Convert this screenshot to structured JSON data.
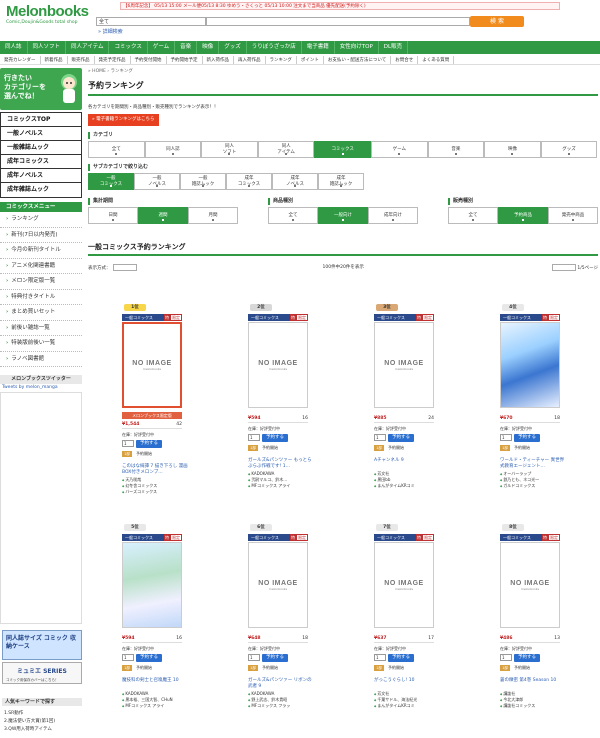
{
  "header": {
    "logo_main": "Melonbooks",
    "logo_sub": "Comic,Doujin&Goods total shop",
    "notice": "【6周年記念】 05/13 15:00 メール便05/13 8:30 ゆめう・さくっと 05/13 10:00 注文まで当商品 優先配送(予約除く)",
    "search_select": "全て",
    "search_button": "検 索",
    "search_detail": "» 詳細検索"
  },
  "global_nav": [
    "同人誌",
    "同人ソフト",
    "同人アイテム",
    "コミックス",
    "ゲーム",
    "音楽",
    "映像",
    "グッズ",
    "うりぼうざっか店",
    "電子書籍",
    "女性向けTOP",
    "DL販売"
  ],
  "sub_nav": [
    "発売カレンダー",
    "新着作品",
    "販売作品",
    "発売予定作品",
    "予約受付開始",
    "予約開始予定",
    "新入荷作品",
    "再入荷作品",
    "ランキング",
    "ポイント",
    "お支払い・配送方法について",
    "お問合せ",
    "よくある質問"
  ],
  "sidebar": {
    "banner_text": "行きたい\nカテゴリーを\n選んでね！",
    "categories": [
      "コミックスTOP",
      "一般ノベルス",
      "一般雑誌ムック",
      "成年コミックス",
      "成年ノベルス",
      "成年雑誌ムック"
    ],
    "menu_title": "コミックスメニュー",
    "menu_items": [
      "ランキング",
      "新刊(7日以内発売)",
      "今月の新刊タイトル",
      "アニメ化関連書籍",
      "メロン限定版一覧",
      "特典付きタイトル",
      "まとめ買いセット",
      "前後い雑誌一覧",
      "特装版前後い一覧",
      "ラノベ図書館"
    ],
    "twitter_title": "メロンブックスツイッター",
    "twitter_sub": "Tweets by melon_manga",
    "ad1": "同人誌サイズ コミック 収納ケース",
    "ad2": "ミュミエ SERIES",
    "ad2_sub": "コミック用保存カバーはこちら！",
    "keywords_title": "人気キーワードで探す",
    "keywords": [
      "1.SR動作",
      "2.魔法使い方大賞(第1回)",
      "3.QW用入荷時アイテム"
    ]
  },
  "main": {
    "breadcrumb": "» HOME › ランキング",
    "page_title": "予約ランキング",
    "description": "各カテゴリを期間別・商品種別・販売種別でランキング表示！！",
    "red_button": "» 電子書籍ランキングはこちら",
    "category_heading": "カテゴリ",
    "categories": [
      {
        "label": "全て",
        "on": false
      },
      {
        "label": "同人誌",
        "on": false
      },
      {
        "label": "同人\nソフト",
        "on": false
      },
      {
        "label": "同人\nアイテム",
        "on": false
      },
      {
        "label": "コミックス",
        "on": true
      },
      {
        "label": "ゲーム",
        "on": false
      },
      {
        "label": "音楽",
        "on": false
      },
      {
        "label": "映像",
        "on": false
      },
      {
        "label": "グッズ",
        "on": false
      }
    ],
    "subcategory_heading": "サブカテゴリで絞り込む",
    "subcategories": [
      {
        "label": "一般\nコミックス",
        "on": true
      },
      {
        "label": "一般\nノベルス",
        "on": false
      },
      {
        "label": "一般\n雑誌ムック",
        "on": false
      },
      {
        "label": "成年\nコミックス",
        "on": false
      },
      {
        "label": "成年\nノベルス",
        "on": false
      },
      {
        "label": "成年\n雑誌ムック",
        "on": false
      }
    ],
    "period_heading": "集計期間",
    "periods": [
      {
        "label": "日間",
        "on": false
      },
      {
        "label": "週間",
        "on": true
      },
      {
        "label": "月間",
        "on": false
      }
    ],
    "type_heading": "商品種別",
    "types": [
      {
        "label": "全て",
        "on": false
      },
      {
        "label": "一般向け",
        "on": true
      },
      {
        "label": "成年向け",
        "on": false
      }
    ],
    "sale_heading": "販売種別",
    "sales": [
      {
        "label": "全て",
        "on": false
      },
      {
        "label": "予約商品",
        "on": true
      },
      {
        "label": "発売中商品",
        "on": false
      }
    ],
    "ranking_title": "一般コミックス予約ランキング",
    "pager_left": "表示方式：",
    "pager_count": "100件中20件を表示",
    "pager_page": "1/5ページ"
  },
  "products": [
    {
      "rank": "1位",
      "badge": "b1",
      "cat": "一般コミックス",
      "image": "noimage",
      "red": true,
      "limited": "メロンブックス限定版",
      "price": "¥1,544",
      "points": "42",
      "status": "在庫：好評受付中",
      "qty": "1",
      "cart": "予約する",
      "label": "1部",
      "ltext": "予約開始",
      "title": "このはな綺譚 7 描き下ろし 漫画BOX付きメロンブ…",
      "meta": [
        "天乃咲哉",
        "幻冬舎コミックス",
        "バーズコミックス"
      ]
    },
    {
      "rank": "2位",
      "badge": "b2",
      "cat": "一般コミックス",
      "image": "noimage",
      "red": false,
      "price": "¥594",
      "points": "16",
      "status": "在庫：好評受付中",
      "qty": "1",
      "cart": "予約する",
      "label": "1部",
      "ltext": "予約開始",
      "title": "ガールズ&パンツァー もっとらぶらぶ作戦です! 1…",
      "meta": [
        "KADOKAWA",
        "弐尉マルコ、鈴木…",
        "MFコミックス アライ"
      ]
    },
    {
      "rank": "3位",
      "badge": "b3",
      "cat": "一般コミックス",
      "image": "noimage",
      "red": false,
      "price": "¥885",
      "points": "24",
      "status": "在庫：好評受付中",
      "qty": "1",
      "cart": "予約する",
      "label": "1部",
      "ltext": "予約開始",
      "title": "Aチャンネル 9",
      "meta": [
        "芳文社",
        "黒田bb",
        "まんがタイムKRコミ"
      ]
    },
    {
      "rank": "4位",
      "badge": "bn",
      "cat": "一般コミックス",
      "image": "cover",
      "red": false,
      "price": "¥670",
      "points": "18",
      "status": "在庫：好評受付中",
      "qty": "1",
      "cart": "予約する",
      "label": "1部",
      "ltext": "予約開始",
      "title": "ワールド・ティーチャー 異世界式教育エージェント…",
      "meta": [
        "オーバーラップ",
        "鉄乃とも、ネコ光一",
        "ガルドコミックス"
      ]
    },
    {
      "rank": "5位",
      "badge": "bn",
      "cat": "一般コミックス",
      "image": "cover2",
      "red": false,
      "price": "¥594",
      "points": "16",
      "status": "在庫：好評受付中",
      "qty": "1",
      "cart": "予約する",
      "label": "1部",
      "ltext": "予約開始",
      "title": "魔技科の剣士と召喚魔王 10",
      "meta": [
        "KADOKAWA",
        "黒本裕、三国大智、CHuN",
        "MFコミックス アライ"
      ]
    },
    {
      "rank": "6位",
      "badge": "bn",
      "cat": "一般コミックス",
      "image": "noimage",
      "red": false,
      "price": "¥648",
      "points": "18",
      "status": "在庫：好評受付中",
      "qty": "1",
      "cart": "予約する",
      "label": "1部",
      "ltext": "予約開始",
      "title": "ガールズ&パンツァー リボンの武者 9",
      "meta": [
        "KADOKAWA",
        "野上武志、鈴木貴昭",
        "MFコミックス フラッ"
      ]
    },
    {
      "rank": "7位",
      "badge": "bn",
      "cat": "一般コミックス",
      "image": "noimage",
      "red": false,
      "price": "¥637",
      "points": "17",
      "status": "在庫：好評受付中",
      "qty": "1",
      "cart": "予約する",
      "label": "1部",
      "ltext": "予約開始",
      "title": "がっこうぐらし! 10",
      "meta": [
        "芳文社",
        "千葉サドル、海法紀光",
        "まんがタイムKRコミ"
      ]
    },
    {
      "rank": "8位",
      "badge": "bn",
      "cat": "一般コミックス",
      "image": "noimage",
      "red": false,
      "price": "¥486",
      "points": "13",
      "status": "在庫：好評受付中",
      "qty": "1",
      "cart": "予約する",
      "label": "1部",
      "ltext": "予約開始",
      "title": "蒼の緻密 第4巻 Season 10",
      "meta": [
        "講談社",
        "今北大津郎",
        "講談社コミックス"
      ]
    }
  ],
  "noimage_text": "NO IMAGE",
  "noimage_sub": "melonbooks",
  "tag_labels": {
    "red": "特",
    "special": "限定"
  }
}
